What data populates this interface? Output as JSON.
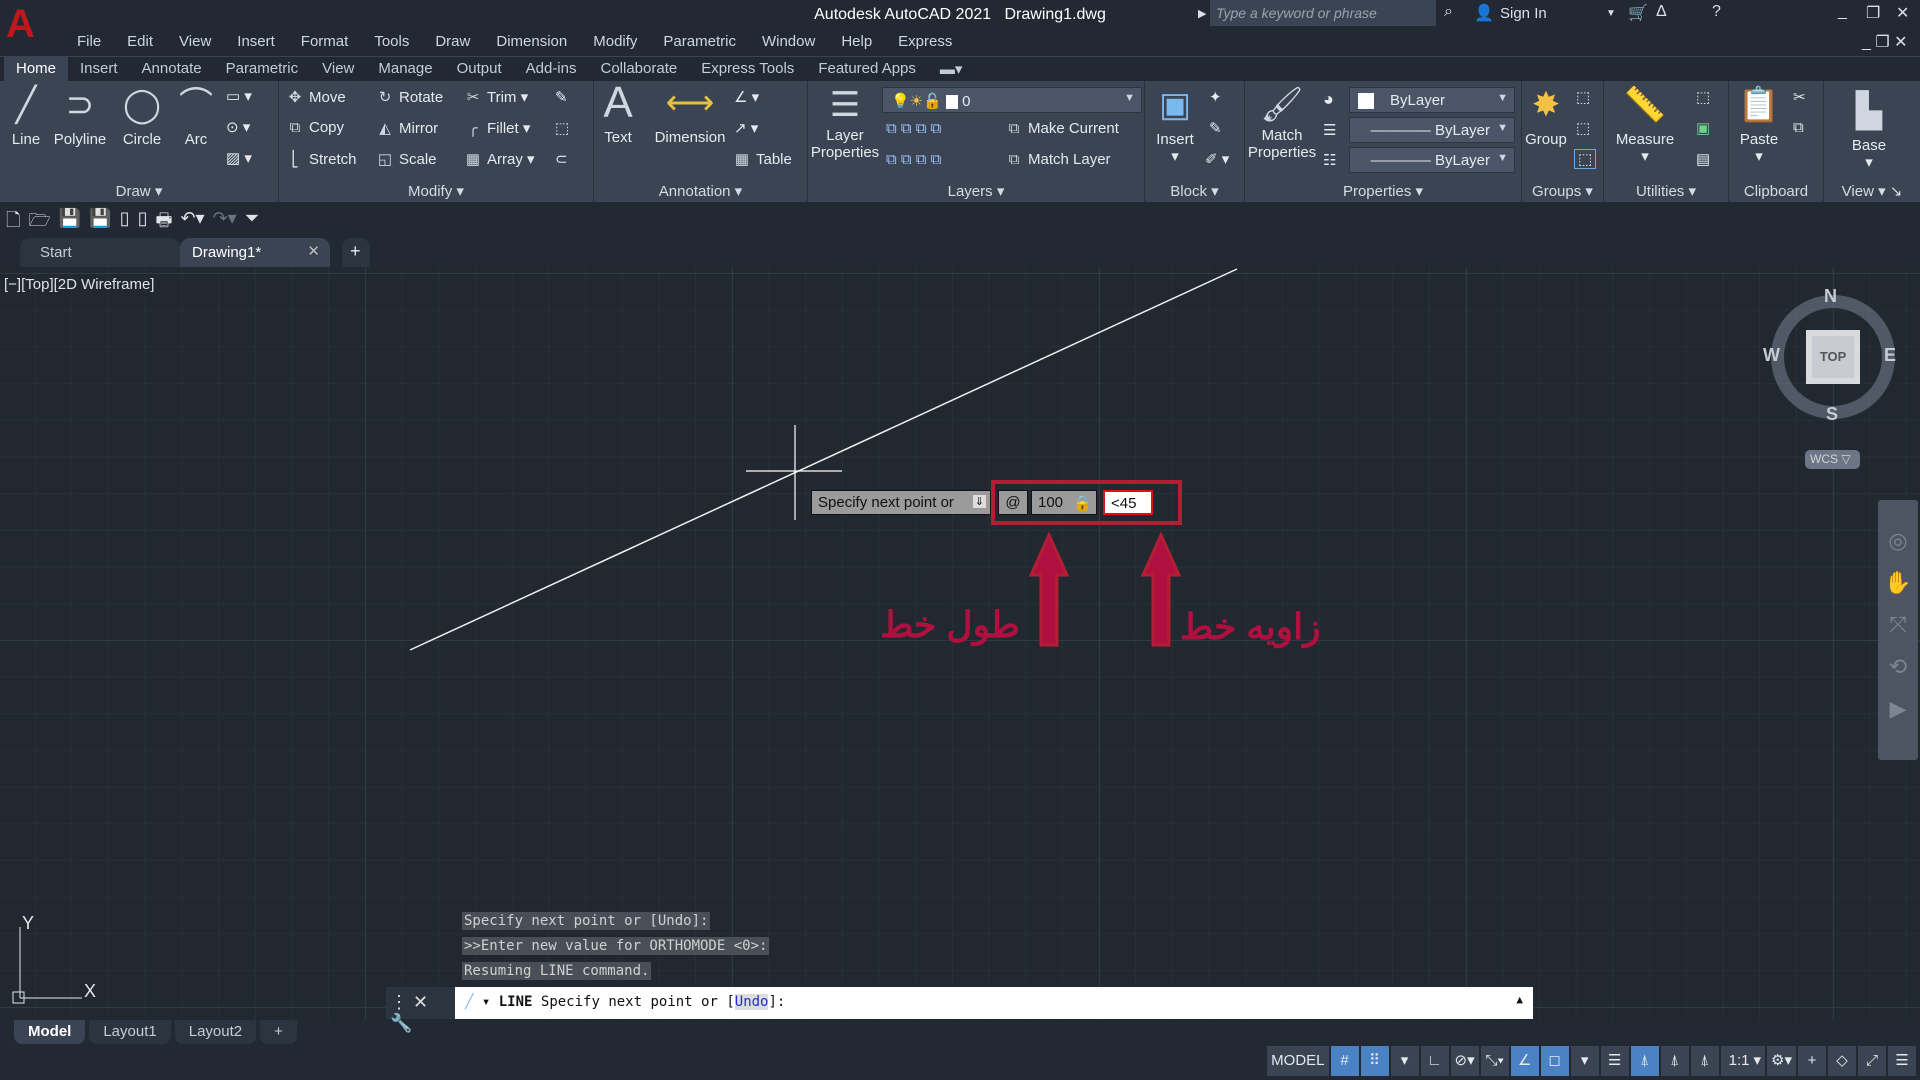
{
  "title": {
    "app": "Autodesk AutoCAD 2021",
    "file": "Drawing1.dwg",
    "search_placeholder": "Type a keyword or phrase",
    "sign_in": "Sign In"
  },
  "menu": [
    "File",
    "Edit",
    "View",
    "Insert",
    "Format",
    "Tools",
    "Draw",
    "Dimension",
    "Modify",
    "Parametric",
    "Window",
    "Help",
    "Express"
  ],
  "ribbon_tabs": [
    "Home",
    "Insert",
    "Annotate",
    "Parametric",
    "View",
    "Manage",
    "Output",
    "Add-ins",
    "Collaborate",
    "Express Tools",
    "Featured Apps"
  ],
  "panels": {
    "draw": {
      "label": "Draw",
      "line": "Line",
      "polyline": "Polyline",
      "circle": "Circle",
      "arc": "Arc"
    },
    "modify": {
      "label": "Modify",
      "move": "Move",
      "rotate": "Rotate",
      "trim": "Trim",
      "copy": "Copy",
      "mirror": "Mirror",
      "fillet": "Fillet",
      "stretch": "Stretch",
      "scale": "Scale",
      "array": "Array"
    },
    "annotation": {
      "label": "Annotation",
      "text": "Text",
      "dimension": "Dimension",
      "table": "Table"
    },
    "layers": {
      "label": "Layers",
      "layer_properties_1": "Layer",
      "layer_properties_2": "Properties",
      "current_layer": "0",
      "make_current": "Make Current",
      "match_layer": "Match Layer"
    },
    "block": {
      "label": "Block",
      "insert": "Insert"
    },
    "properties": {
      "label": "Properties",
      "match_1": "Match",
      "match_2": "Properties",
      "color": "ByLayer",
      "lineweight": "ByLayer",
      "linetype": "ByLayer"
    },
    "groups": {
      "label": "Groups",
      "group": "Group"
    },
    "utilities": {
      "label": "Utilities",
      "measure": "Measure"
    },
    "clipboard": {
      "label": "Clipboard",
      "paste": "Paste"
    },
    "view": {
      "label": "View",
      "base": "Base"
    }
  },
  "file_tabs": {
    "start": "Start",
    "drawing": "Drawing1*"
  },
  "viewport": {
    "controls": "[−][Top][2D Wireframe]",
    "viewcube": {
      "top": "TOP",
      "n": "N",
      "s": "S",
      "e": "E",
      "w": "W",
      "wcs": "WCS"
    },
    "ucs_x": "X",
    "ucs_y": "Y"
  },
  "dynamic_input": {
    "prompt": "Specify next point or",
    "relative": "@",
    "length": "100",
    "angle": "<45"
  },
  "annotations": {
    "length_label": "طول خط",
    "angle_label": "زاویه خط",
    "color": "#b0103f"
  },
  "command_history": [
    "Specify next point or [Undo]:",
    ">>Enter new value for ORTHOMODE <0>:",
    "Resuming LINE command."
  ],
  "command_line": {
    "command": "LINE",
    "prompt": "Specify next point or [",
    "option": "Undo",
    "end": "]:"
  },
  "layout_tabs": [
    "Model",
    "Layout1",
    "Layout2"
  ],
  "status_bar": {
    "model": "MODEL",
    "scale": "1:1"
  }
}
